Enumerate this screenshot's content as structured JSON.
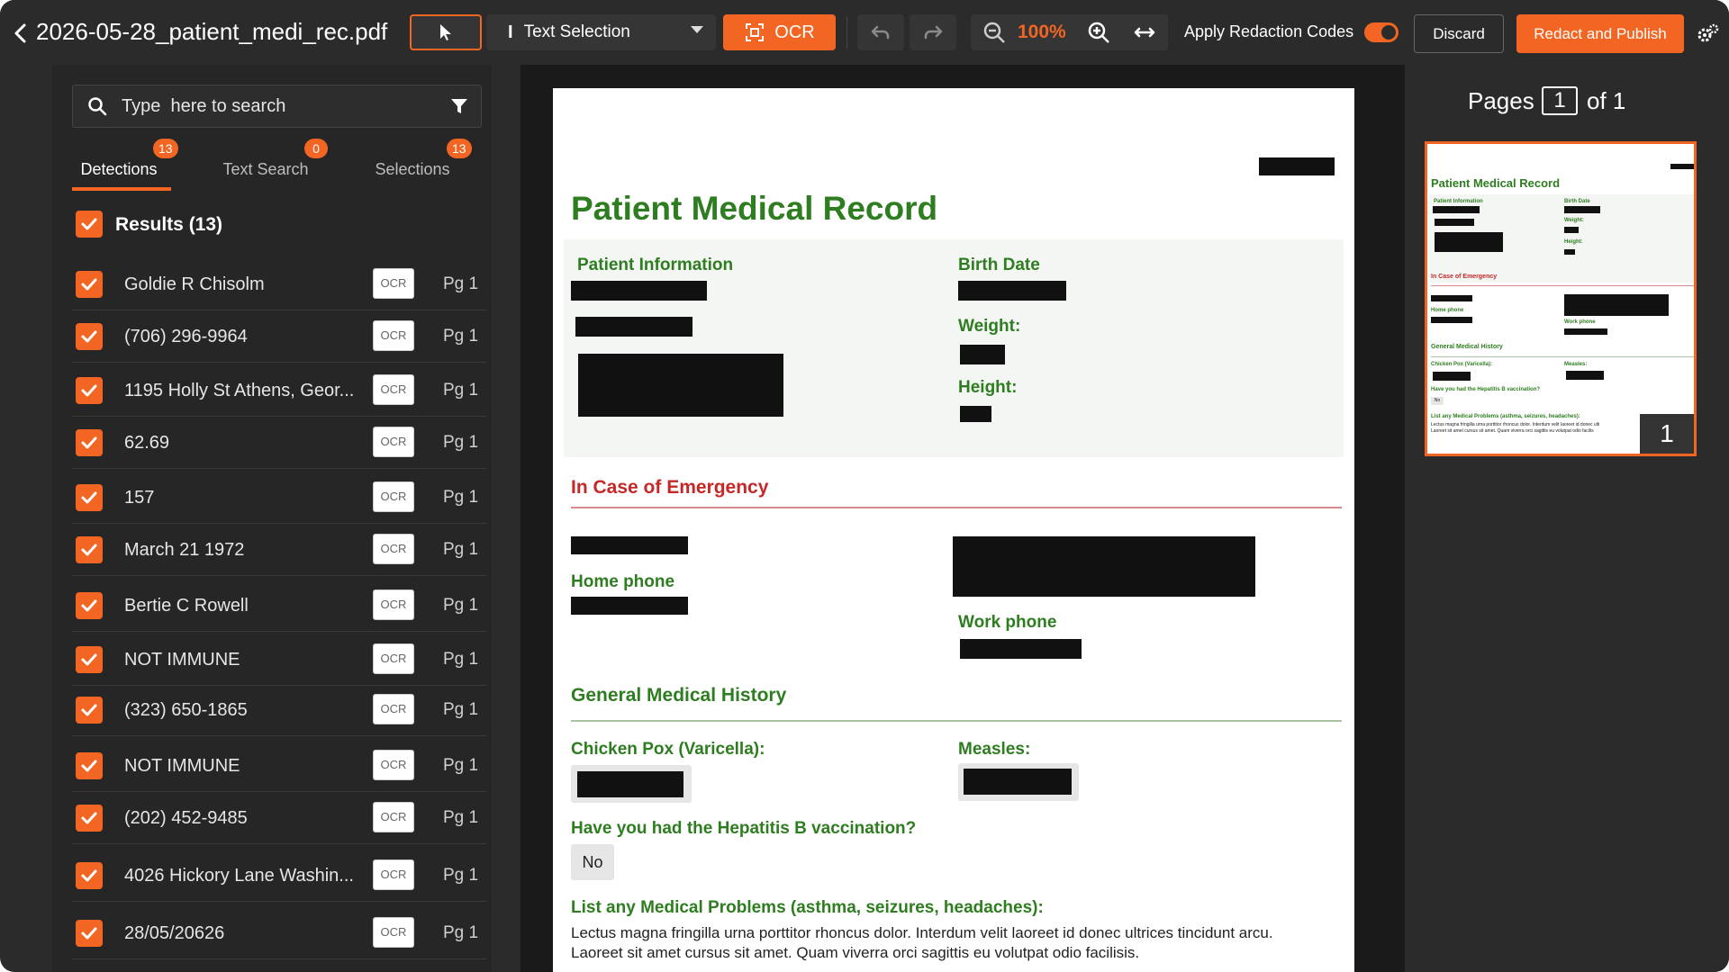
{
  "header": {
    "file_name": "2026-05-28_patient_medi_rec.pdf",
    "text_selection_label": "Text Selection",
    "ocr_label": "OCR",
    "zoom": "100%",
    "apply_redaction_label": "Apply Redaction Codes",
    "apply_redaction_on": true,
    "discard_label": "Discard",
    "publish_label": "Redact and Publish"
  },
  "search": {
    "placeholder": "Type  here to search"
  },
  "tabs": [
    {
      "label": "Detections",
      "count": "13",
      "active": true
    },
    {
      "label": "Text Search",
      "count": "0",
      "active": false
    },
    {
      "label": "Selections",
      "count": "13",
      "active": false
    }
  ],
  "results": {
    "label": "Results (13)",
    "items": [
      {
        "text": "Goldie R Chisolm",
        "tag": "OCR",
        "page": "Pg 1"
      },
      {
        "text": "(706) 296-9964",
        "tag": "OCR",
        "page": "Pg 1"
      },
      {
        "text": "1195 Holly St Athens, Geor...",
        "tag": "OCR",
        "page": "Pg 1"
      },
      {
        "text": "62.69",
        "tag": "OCR",
        "page": "Pg 1"
      },
      {
        "text": "157",
        "tag": "OCR",
        "page": "Pg 1"
      },
      {
        "text": "March 21 1972",
        "tag": "OCR",
        "page": "Pg 1"
      },
      {
        "text": "Bertie C Rowell",
        "tag": "OCR",
        "page": "Pg 1"
      },
      {
        "text": "NOT IMMUNE",
        "tag": "OCR",
        "page": "Pg 1"
      },
      {
        "text": "(323) 650-1865",
        "tag": "OCR",
        "page": "Pg 1"
      },
      {
        "text": "NOT IMMUNE",
        "tag": "OCR",
        "page": "Pg 1"
      },
      {
        "text": "(202) 452-9485",
        "tag": "OCR",
        "page": "Pg 1"
      },
      {
        "text": "4026 Hickory Lane Washin...",
        "tag": "OCR",
        "page": "Pg 1"
      },
      {
        "text": "28/05/20626",
        "tag": "OCR",
        "page": "Pg 1"
      }
    ]
  },
  "document": {
    "title": "Patient Medical Record",
    "patient_info_label": "Patient Information",
    "birth_date_label": "Birth Date",
    "weight_label": "Weight:",
    "height_label": "Height:",
    "emergency_heading": "In Case of Emergency",
    "home_phone_label": "Home phone",
    "work_phone_label": "Work phone",
    "history_heading": "General Medical History",
    "chicken_pox_label": "Chicken Pox (Varicella):",
    "measles_label": "Measles:",
    "hep_b_question": "Have you had the Hepatitis B vaccination?",
    "hep_b_answer": "No",
    "problems_label": "List any Medical Problems (asthma, seizures, headaches):",
    "problems_line1": "Lectus magna fringilla urna porttitor rhoncus dolor. Interdum velit laoreet id donec ultrices tincidunt arcu.",
    "problems_line2": "Laoreet sit amet cursus sit amet. Quam viverra orci sagittis eu volutpat odio facilisis."
  },
  "thumbnail_panel": {
    "pages_label": "Pages",
    "current_page": "1",
    "of_label": "of 1",
    "thumb_page_number": "1"
  },
  "thumbnail_doc": {
    "title": "Patient Medical Record",
    "patient_info_label": "Patient Information",
    "birth_date_label": "Birth Date",
    "weight_label": "Weight:",
    "height_label": "Height:",
    "emergency_heading": "In Case of Emergency",
    "home_phone_label": "Home phone",
    "work_phone_label": "Work phone",
    "history_heading": "General Medical History",
    "chicken_pox_label": "Chicken Pox (Varicella):",
    "measles_label": "Measles:",
    "hep_b_question": "Have you had the Hepatitis B vaccination?",
    "hep_b_answer": "No",
    "problems_label": "List any Medical Problems (asthma, seizures, headaches):",
    "problems_line1": "Lectus magna fringilla urna porttitor rhoncus dolor. Interdum velit laoreet id donec ulti",
    "problems_line2": "Laoreet sit amet cursus sit amet. Quam viverra orci sagittis eu volutpat odio facilis"
  },
  "colors": {
    "accent": "#f26522",
    "doc_green": "#2e7d20",
    "doc_red": "#c62828"
  },
  "icons": [
    "back-arrow-icon",
    "pointer-icon",
    "text-cursor-icon",
    "ocr-scan-icon",
    "undo-icon",
    "redo-icon",
    "zoom-out-icon",
    "zoom-in-icon",
    "fit-width-icon",
    "settings-icon",
    "search-icon",
    "filter-icon",
    "checkbox-checked-icon"
  ]
}
